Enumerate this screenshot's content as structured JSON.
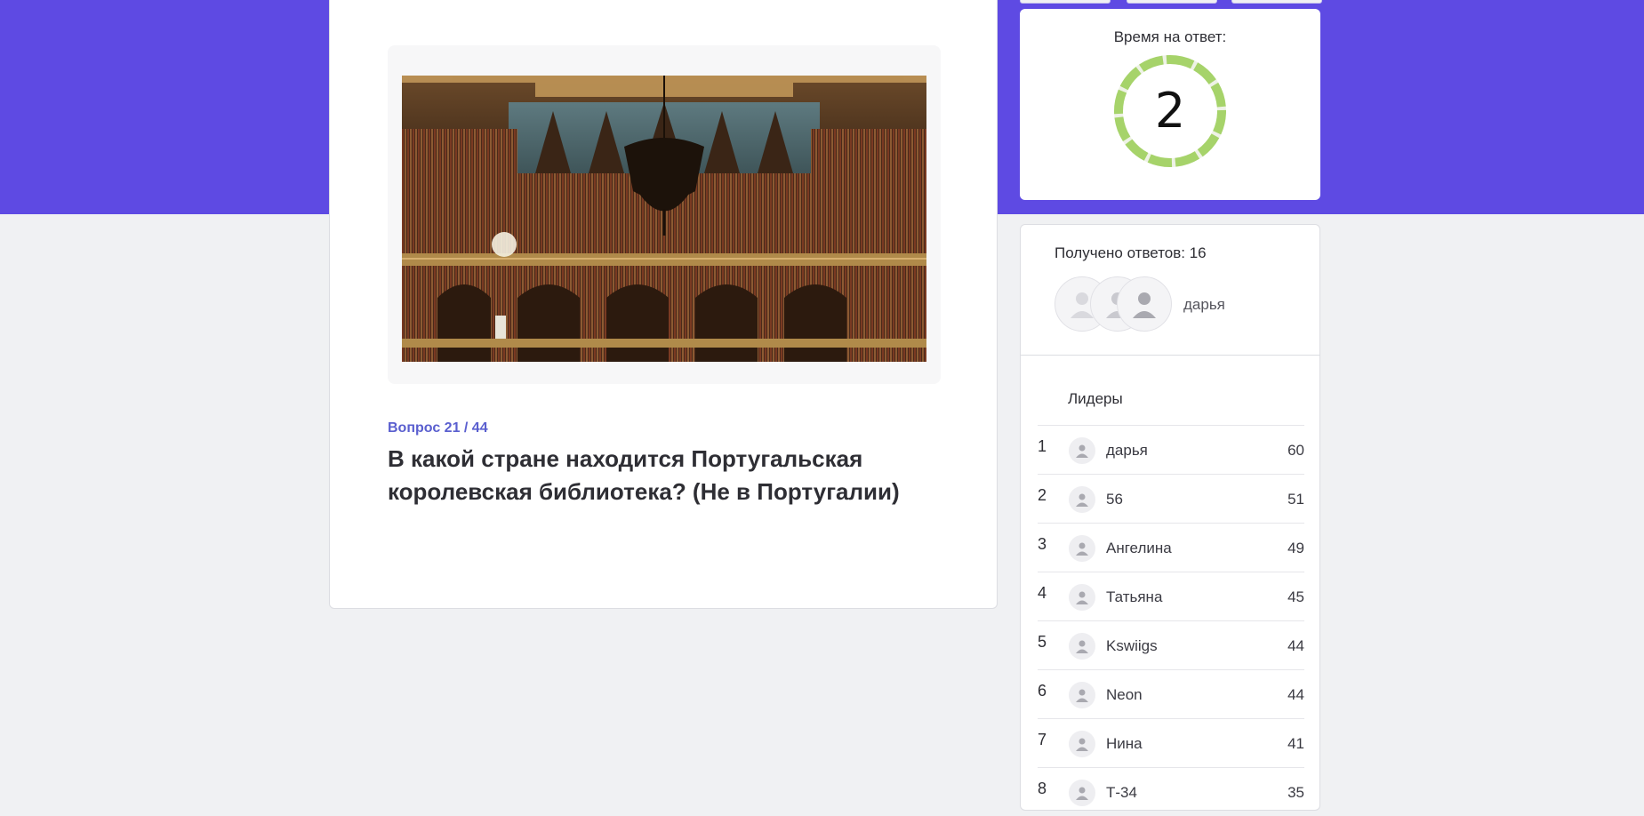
{
  "question": {
    "counter": "Вопрос 21 / 44",
    "text": "В какой стране находится Португальская королевская библиотека? (Не в Португалии)",
    "image_subject": "library-hall-image"
  },
  "timer": {
    "label": "Время на ответ:",
    "value": "2",
    "ring_color": "#a6d36a"
  },
  "answers": {
    "label": "Получено ответов: 16",
    "latest_name": "дарья"
  },
  "leaders": {
    "title": "Лидеры",
    "rows": [
      {
        "rank": "1",
        "name": "дарья",
        "score": "60"
      },
      {
        "rank": "2",
        "name": "56",
        "score": "51"
      },
      {
        "rank": "3",
        "name": "Ангелина",
        "score": "49"
      },
      {
        "rank": "4",
        "name": "Татьяна",
        "score": "45"
      },
      {
        "rank": "5",
        "name": "Kswiigs",
        "score": "44"
      },
      {
        "rank": "6",
        "name": "Neon",
        "score": "44"
      },
      {
        "rank": "7",
        "name": "Нина",
        "score": "41"
      },
      {
        "rank": "8",
        "name": "Т-34",
        "score": "35"
      }
    ]
  },
  "colors": {
    "brand": "#5e4ae3",
    "accent_text": "#5a5fcf",
    "page_bg": "#f0f1f3"
  }
}
